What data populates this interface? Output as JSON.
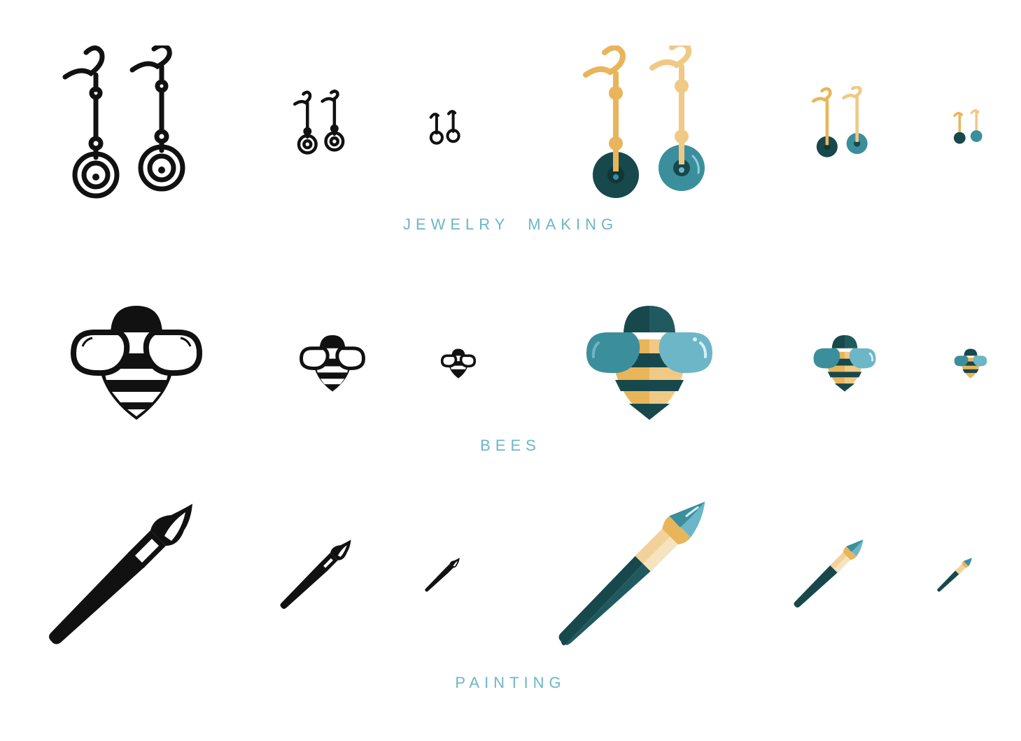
{
  "sections": [
    {
      "id": "jewelry",
      "label": "JEWELRY  MAKING",
      "icon": "earrings-icon"
    },
    {
      "id": "bees",
      "label": "BEES",
      "icon": "bee-icon"
    },
    {
      "id": "painting",
      "label": "PAINTING",
      "icon": "paintbrush-icon"
    }
  ],
  "palette": {
    "line": "#111111",
    "teal_dark": "#17484b",
    "teal": "#3b8f9c",
    "teal_light": "#6cb6c8",
    "gold": "#e9b55a",
    "gold_light": "#f2d29a",
    "cream": "#f6e4c0"
  }
}
